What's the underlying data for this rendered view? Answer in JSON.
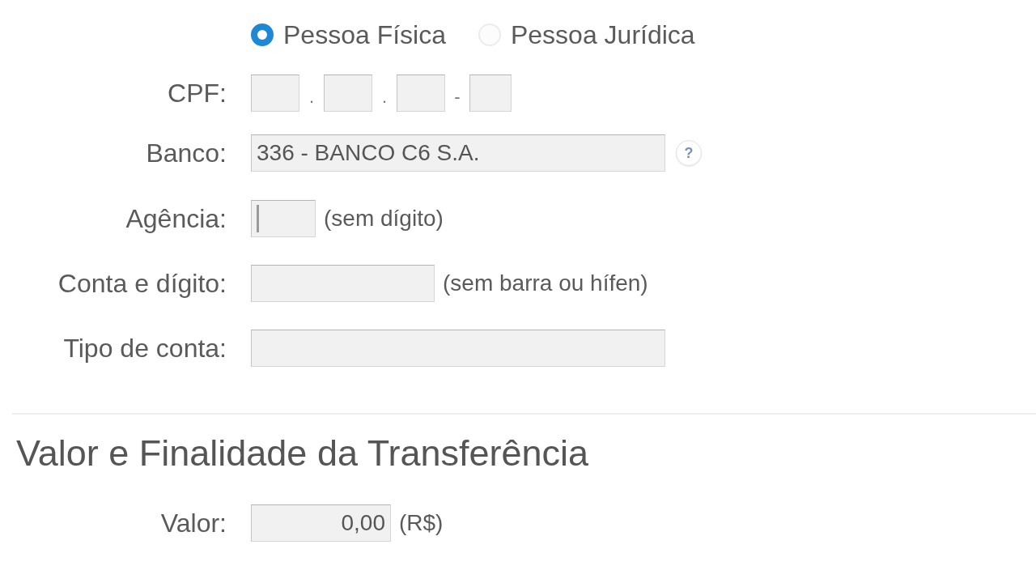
{
  "person_type": {
    "options": [
      {
        "label": "Pessoa Física",
        "selected": true
      },
      {
        "label": "Pessoa Jurídica",
        "selected": false
      }
    ]
  },
  "fields": [
    {
      "kind": "cpf",
      "label": "CPF:",
      "separators": [
        ".",
        ".",
        "-"
      ]
    },
    {
      "kind": "bank",
      "label": "Banco:",
      "value": "336 - BANCO C6 S.A.",
      "help": "?"
    },
    {
      "kind": "branch",
      "label": "Agência:",
      "hint": "(sem dígito)",
      "focused": true
    },
    {
      "kind": "account",
      "label": "Conta e dígito:",
      "hint": "(sem barra ou hífen)"
    },
    {
      "kind": "account_type",
      "label": "Tipo de conta:"
    }
  ],
  "amount_section": {
    "heading": "Valor e Finalidade da Transferência",
    "fields": [
      {
        "kind": "amount",
        "label": "Valor:",
        "value": "0,00",
        "hint": "(R$)"
      }
    ]
  }
}
